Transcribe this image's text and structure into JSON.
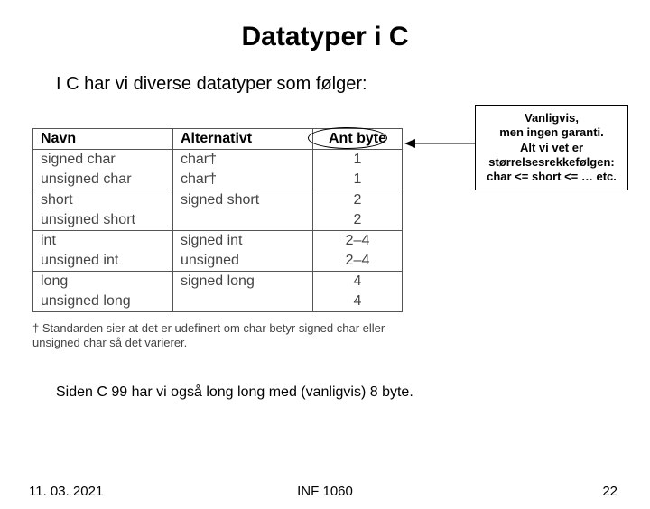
{
  "title": "Datatyper i C",
  "subtitle": "I C har vi diverse datatyper som følger:",
  "table": {
    "headers": {
      "c0": "Navn",
      "c1": "Alternativt",
      "c2": "Ant byte"
    },
    "rows": [
      {
        "c0": "signed char",
        "c1": "char†",
        "c2": "1"
      },
      {
        "c0": "unsigned char",
        "c1": "char†",
        "c2": "1"
      },
      {
        "c0": "short",
        "c1": "signed short",
        "c2": "2"
      },
      {
        "c0": "unsigned short",
        "c1": "",
        "c2": "2"
      },
      {
        "c0": "int",
        "c1": "signed int",
        "c2": "2–4"
      },
      {
        "c0": "unsigned int",
        "c1": "unsigned",
        "c2": "2–4"
      },
      {
        "c0": "long",
        "c1": "signed long",
        "c2": "4"
      },
      {
        "c0": "unsigned long",
        "c1": "",
        "c2": "4"
      }
    ]
  },
  "footnote": "† Standarden sier at det er udefinert om char betyr signed char eller unsigned char så det varierer.",
  "callout": {
    "l1": "Vanligvis,",
    "l2": "men ingen garanti.",
    "l3": "Alt vi vet er",
    "l4": "størrelsesrekkefølgen:",
    "l5": "char <= short <= … etc."
  },
  "below_note": "Siden C 99 har vi også long long med (vanligvis) 8 byte.",
  "footer": {
    "date": "11. 03. 2021",
    "center": "INF 1060",
    "page": "22"
  }
}
